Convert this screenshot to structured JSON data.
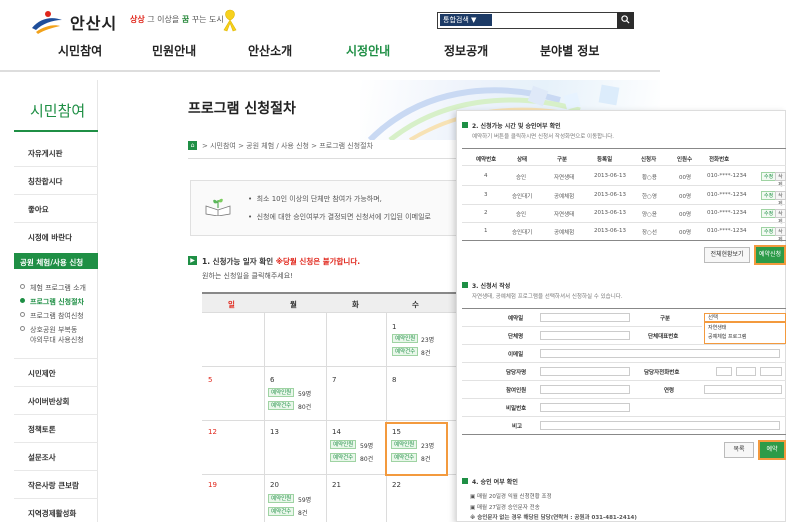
{
  "header": {
    "logo_text": "안산시",
    "slogan_a": "상상",
    "slogan_b": " 그 이상을 ",
    "slogan_c": "꿈",
    "slogan_d": " 꾸는 도시",
    "search_select": "통합검색 ▼",
    "search_icon": "search-icon",
    "gnb": [
      "시민참여",
      "민원안내",
      "안산소개",
      "시정안내",
      "정보공개",
      "분야별 정보"
    ]
  },
  "sidebar": {
    "title": "시민참여",
    "items": [
      "자유게시판",
      "칭찬합시다",
      "좋아요",
      "시정에 바란다",
      "공원 체험/사용 신청",
      "시민제안",
      "사이버반상회",
      "정책토론",
      "설문조사",
      "작은사랑 큰보람",
      "지역경제활성화"
    ],
    "sub_items": [
      "체험 프로그램 소개",
      "프로그램 신청절차",
      "프로그램 참여신청",
      "상호공원 부복동\n야외무대 사용신청"
    ]
  },
  "main": {
    "page_title": "프로그램 신청절차",
    "breadcrumb": "> 시민참여 > 공원 체험 / 사용 신청 > 프로그램 신청절차",
    "notices": [
      "최소 10인 이상의 단체만 참여가 가능하며,",
      "신청에 대한 승인여부가 결정되면 신청서에 기입된 이메일로"
    ],
    "step1_title": "1. 신청가능 일자 확인 ",
    "step1_warn": "※당월 신청은 불가합니다.",
    "step1_sub": "원하는 신청일을 클릭해주세요!"
  },
  "calendar": {
    "headers": [
      "일",
      "월",
      "화",
      "수"
    ],
    "days": [
      "1",
      "5",
      "6",
      "7",
      "8",
      "12",
      "13",
      "14",
      "15",
      "19",
      "20",
      "21",
      "22"
    ],
    "chip_applied": "예약인원",
    "chip_count": "예약건수",
    "cells": {
      "d1": [
        "23명",
        "8건"
      ],
      "d6": [
        "59명",
        "80건"
      ],
      "d14": [
        "59명",
        "80건"
      ],
      "d15": [
        "23명",
        "8건"
      ],
      "d20": [
        "59명",
        "8건"
      ]
    }
  },
  "panel": {
    "step2_title": "2. 신청가능 시간 및 승인여부 확인",
    "step2_desc": "예약하기 버튼을 클릭하시면 신청서 작성화면으로 이동합니다.",
    "table_headers": [
      "예약번호",
      "상태",
      "구분",
      "등록일",
      "신청자",
      "인원수",
      "전화번호"
    ],
    "rows": [
      [
        "4",
        "승인",
        "자연생태",
        "2013-06-13",
        "황○용",
        "00명",
        "010-****-1234"
      ],
      [
        "3",
        "승인대기",
        "공예체험",
        "2013-06-13",
        "한○영",
        "00명",
        "010-****-1234"
      ],
      [
        "2",
        "승인",
        "자연생태",
        "2013-06-13",
        "양○윤",
        "00명",
        "010-****-1234"
      ],
      [
        "1",
        "승인대기",
        "공예체험",
        "2013-06-13",
        "장○선",
        "00명",
        "010-****-1234"
      ]
    ],
    "row_btn_edit": "수정",
    "row_btn_del": "삭제",
    "btn_all": "전체현황보기",
    "btn_reserve": "예약신청",
    "step3_title": "3. 신청서 작성",
    "step3_desc": "자연생태, 공예체험 프로그램을 선택하셔서 신청하실 수 있습니다.",
    "form_labels": [
      "예약일",
      "단체명",
      "이메일",
      "담당자명",
      "참여인원",
      "비밀번호",
      "비고"
    ],
    "form_labels_right": [
      "구분",
      "단체대표번호",
      "담당자전화번호",
      "연령"
    ],
    "select_value": "선택",
    "dropdown_options": [
      "자연생태",
      "공예체험 프로그램"
    ],
    "btn_list": "목록",
    "btn_submit": "예약",
    "step4_title": "4. 승인 여부 확인",
    "step4_notes": [
      "매월 20일경 익월 신청현황 조정",
      "매월 27일경 승인문자 전송",
      "※ 승인문자 없는 경우 해당된 담당(연락처 : 공원과 031-481-2414)"
    ]
  }
}
